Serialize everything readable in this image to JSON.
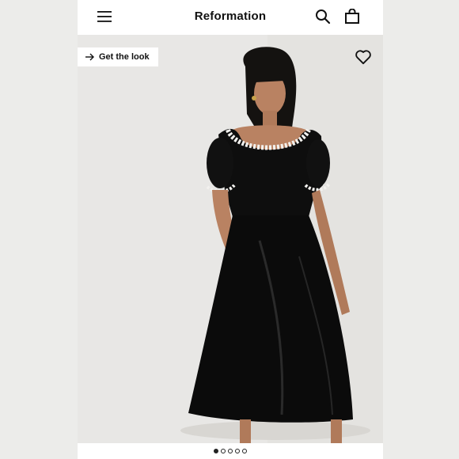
{
  "header": {
    "brand": "Reformation",
    "menu_icon": "hamburger-menu-icon",
    "search_icon": "search-icon",
    "bag_icon": "shopping-bag-icon"
  },
  "product_image": {
    "get_the_look_label": "Get the look",
    "arrow_icon": "arrow-right-icon",
    "wishlist_icon": "heart-icon"
  },
  "pagination": {
    "total": 5,
    "current": 1
  },
  "colors": {
    "background": "#efefee",
    "header": "#ffffff",
    "text": "#111111"
  }
}
